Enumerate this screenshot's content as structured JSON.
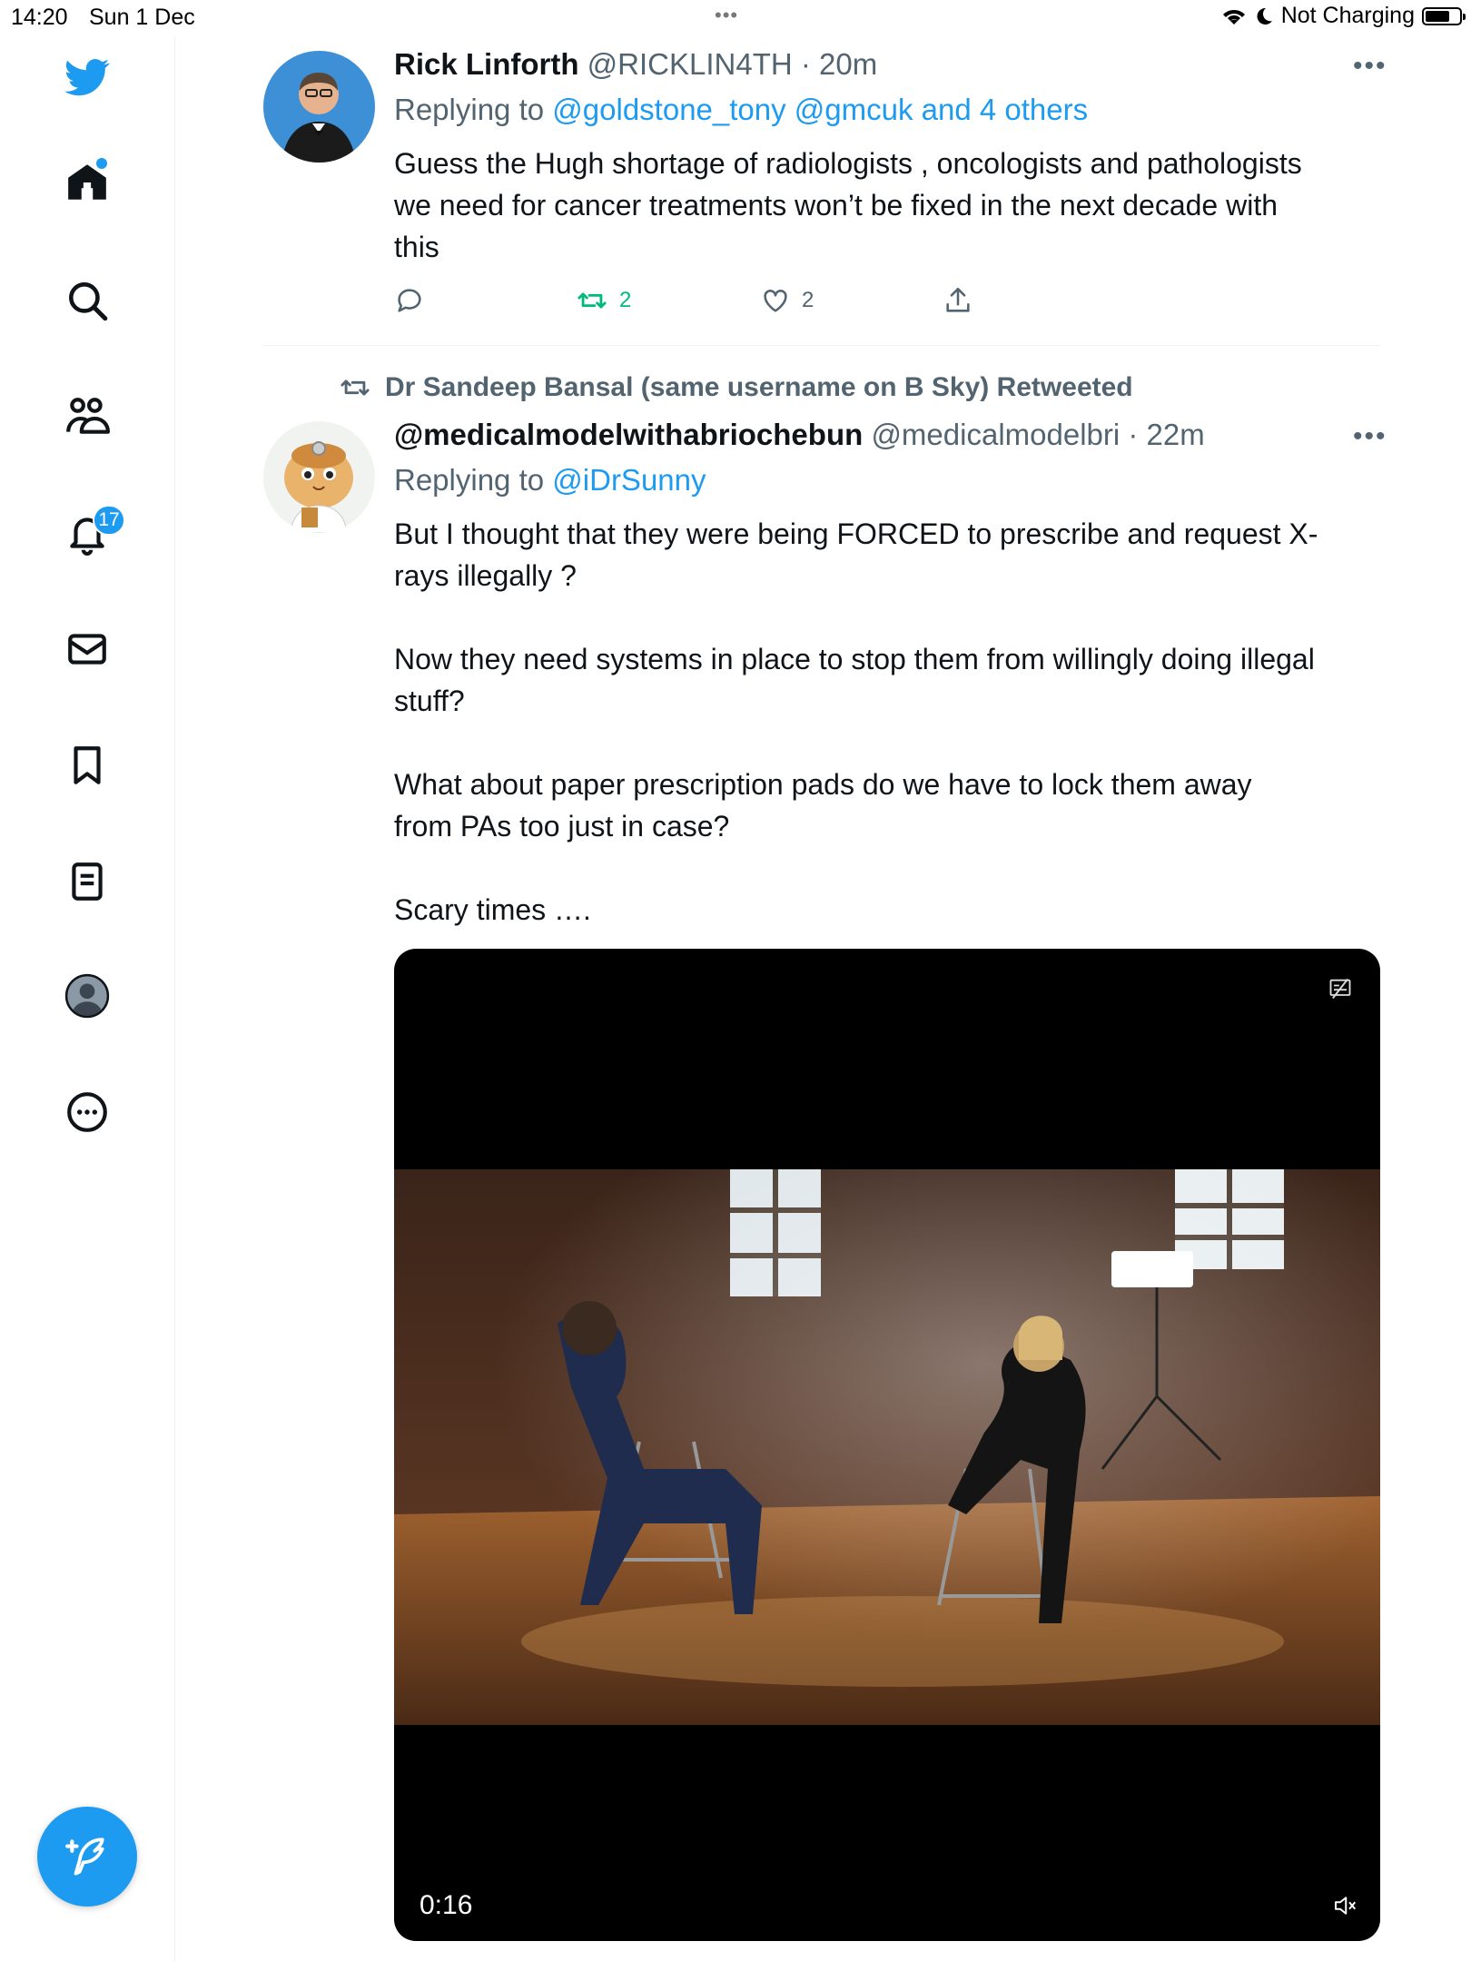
{
  "status_bar": {
    "time": "14:20",
    "date": "Sun 1 Dec",
    "charging": "Not Charging"
  },
  "sidebar": {
    "notifications_badge": "17",
    "items": [
      {
        "name": "twitter-logo",
        "icon": "bird-icon"
      },
      {
        "name": "home",
        "icon": "home-icon"
      },
      {
        "name": "explore",
        "icon": "search-icon"
      },
      {
        "name": "communities",
        "icon": "people-icon"
      },
      {
        "name": "notifications",
        "icon": "bell-icon"
      },
      {
        "name": "messages",
        "icon": "envelope-icon"
      },
      {
        "name": "bookmarks",
        "icon": "bookmark-icon"
      },
      {
        "name": "lists",
        "icon": "list-icon"
      },
      {
        "name": "profile",
        "icon": "avatar-icon"
      },
      {
        "name": "more",
        "icon": "more-circle-icon"
      }
    ]
  },
  "tweet1": {
    "name": "Rick Linforth",
    "handle": "@RICKLIN4TH",
    "time": "20m",
    "replying_prefix": "Replying to",
    "replying_to": "@goldstone_tony @gmcuk and 4 others",
    "text_lines": [
      "Guess the Hugh shortage of radiologists , oncologists and pathologists",
      "we need for cancer treatments won’t be fixed in the next decade with",
      "this"
    ],
    "retweets": "2",
    "likes": "2"
  },
  "tweet2": {
    "retweeted_by": "Dr Sandeep Bansal (same username on B Sky) Retweeted",
    "name": "@medicalmodelwithabriochebun",
    "handle": "@medicalmodelbri",
    "time": "22m",
    "replying_prefix": "Replying to",
    "replying_to": "@iDrSunny",
    "para1_lines": [
      "But I thought that they were being FORCED to prescribe and request X-",
      "rays illegally ?"
    ],
    "para2_lines": [
      "Now they need systems in place to stop them from willingly doing illegal",
      "stuff?"
    ],
    "para3_lines": [
      "What about paper prescription pads do we have to lock them away",
      "from PAs too just in case?"
    ],
    "para4": "Scary times …."
  },
  "video": {
    "duration": "0:16"
  },
  "colors": {
    "brand": "#1d9bf0",
    "text": "#0f1419",
    "muted": "#536471",
    "retweet": "#00ba7c"
  }
}
